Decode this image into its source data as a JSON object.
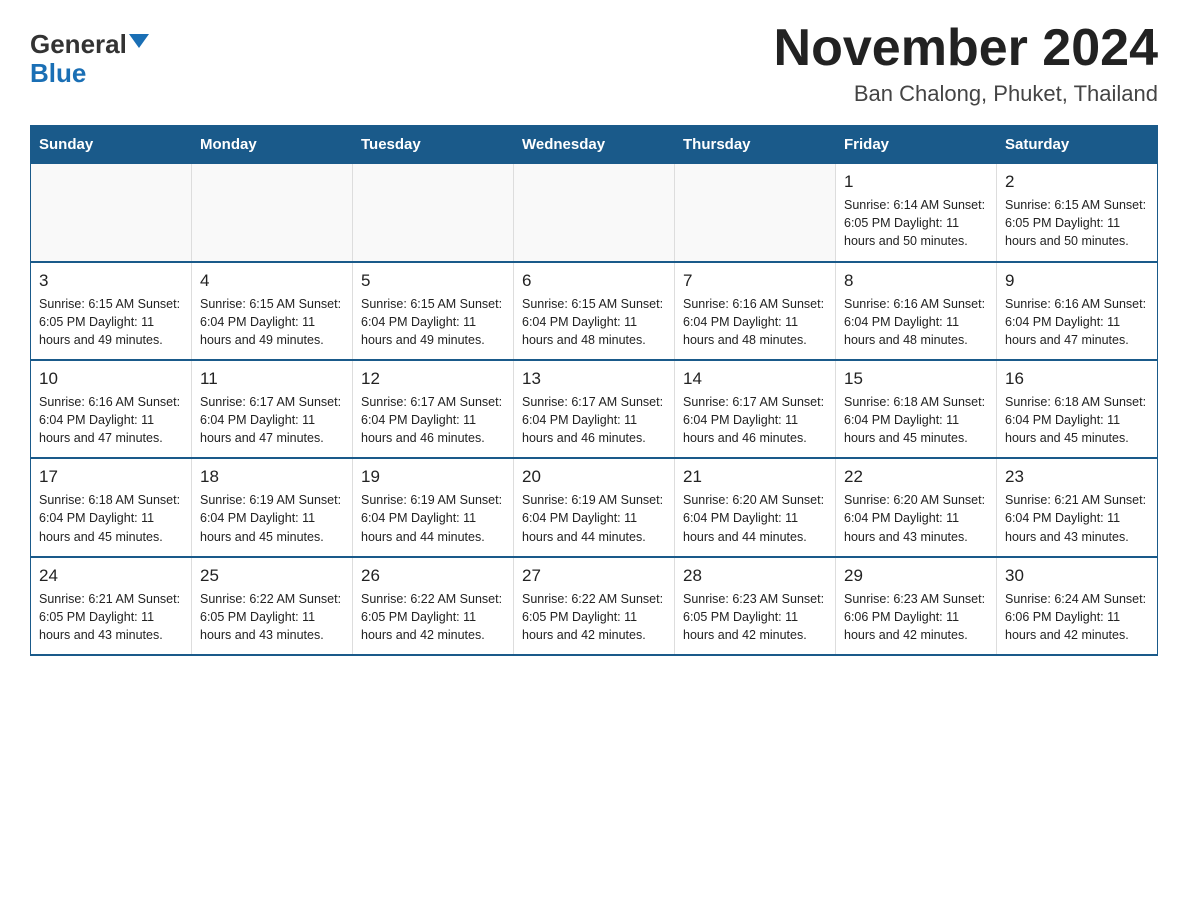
{
  "header": {
    "logo_general": "General",
    "logo_blue": "Blue",
    "month_title": "November 2024",
    "location": "Ban Chalong, Phuket, Thailand"
  },
  "days_of_week": [
    "Sunday",
    "Monday",
    "Tuesday",
    "Wednesday",
    "Thursday",
    "Friday",
    "Saturday"
  ],
  "weeks": [
    [
      {
        "day": "",
        "info": ""
      },
      {
        "day": "",
        "info": ""
      },
      {
        "day": "",
        "info": ""
      },
      {
        "day": "",
        "info": ""
      },
      {
        "day": "",
        "info": ""
      },
      {
        "day": "1",
        "info": "Sunrise: 6:14 AM\nSunset: 6:05 PM\nDaylight: 11 hours and 50 minutes."
      },
      {
        "day": "2",
        "info": "Sunrise: 6:15 AM\nSunset: 6:05 PM\nDaylight: 11 hours and 50 minutes."
      }
    ],
    [
      {
        "day": "3",
        "info": "Sunrise: 6:15 AM\nSunset: 6:05 PM\nDaylight: 11 hours and 49 minutes."
      },
      {
        "day": "4",
        "info": "Sunrise: 6:15 AM\nSunset: 6:04 PM\nDaylight: 11 hours and 49 minutes."
      },
      {
        "day": "5",
        "info": "Sunrise: 6:15 AM\nSunset: 6:04 PM\nDaylight: 11 hours and 49 minutes."
      },
      {
        "day": "6",
        "info": "Sunrise: 6:15 AM\nSunset: 6:04 PM\nDaylight: 11 hours and 48 minutes."
      },
      {
        "day": "7",
        "info": "Sunrise: 6:16 AM\nSunset: 6:04 PM\nDaylight: 11 hours and 48 minutes."
      },
      {
        "day": "8",
        "info": "Sunrise: 6:16 AM\nSunset: 6:04 PM\nDaylight: 11 hours and 48 minutes."
      },
      {
        "day": "9",
        "info": "Sunrise: 6:16 AM\nSunset: 6:04 PM\nDaylight: 11 hours and 47 minutes."
      }
    ],
    [
      {
        "day": "10",
        "info": "Sunrise: 6:16 AM\nSunset: 6:04 PM\nDaylight: 11 hours and 47 minutes."
      },
      {
        "day": "11",
        "info": "Sunrise: 6:17 AM\nSunset: 6:04 PM\nDaylight: 11 hours and 47 minutes."
      },
      {
        "day": "12",
        "info": "Sunrise: 6:17 AM\nSunset: 6:04 PM\nDaylight: 11 hours and 46 minutes."
      },
      {
        "day": "13",
        "info": "Sunrise: 6:17 AM\nSunset: 6:04 PM\nDaylight: 11 hours and 46 minutes."
      },
      {
        "day": "14",
        "info": "Sunrise: 6:17 AM\nSunset: 6:04 PM\nDaylight: 11 hours and 46 minutes."
      },
      {
        "day": "15",
        "info": "Sunrise: 6:18 AM\nSunset: 6:04 PM\nDaylight: 11 hours and 45 minutes."
      },
      {
        "day": "16",
        "info": "Sunrise: 6:18 AM\nSunset: 6:04 PM\nDaylight: 11 hours and 45 minutes."
      }
    ],
    [
      {
        "day": "17",
        "info": "Sunrise: 6:18 AM\nSunset: 6:04 PM\nDaylight: 11 hours and 45 minutes."
      },
      {
        "day": "18",
        "info": "Sunrise: 6:19 AM\nSunset: 6:04 PM\nDaylight: 11 hours and 45 minutes."
      },
      {
        "day": "19",
        "info": "Sunrise: 6:19 AM\nSunset: 6:04 PM\nDaylight: 11 hours and 44 minutes."
      },
      {
        "day": "20",
        "info": "Sunrise: 6:19 AM\nSunset: 6:04 PM\nDaylight: 11 hours and 44 minutes."
      },
      {
        "day": "21",
        "info": "Sunrise: 6:20 AM\nSunset: 6:04 PM\nDaylight: 11 hours and 44 minutes."
      },
      {
        "day": "22",
        "info": "Sunrise: 6:20 AM\nSunset: 6:04 PM\nDaylight: 11 hours and 43 minutes."
      },
      {
        "day": "23",
        "info": "Sunrise: 6:21 AM\nSunset: 6:04 PM\nDaylight: 11 hours and 43 minutes."
      }
    ],
    [
      {
        "day": "24",
        "info": "Sunrise: 6:21 AM\nSunset: 6:05 PM\nDaylight: 11 hours and 43 minutes."
      },
      {
        "day": "25",
        "info": "Sunrise: 6:22 AM\nSunset: 6:05 PM\nDaylight: 11 hours and 43 minutes."
      },
      {
        "day": "26",
        "info": "Sunrise: 6:22 AM\nSunset: 6:05 PM\nDaylight: 11 hours and 42 minutes."
      },
      {
        "day": "27",
        "info": "Sunrise: 6:22 AM\nSunset: 6:05 PM\nDaylight: 11 hours and 42 minutes."
      },
      {
        "day": "28",
        "info": "Sunrise: 6:23 AM\nSunset: 6:05 PM\nDaylight: 11 hours and 42 minutes."
      },
      {
        "day": "29",
        "info": "Sunrise: 6:23 AM\nSunset: 6:06 PM\nDaylight: 11 hours and 42 minutes."
      },
      {
        "day": "30",
        "info": "Sunrise: 6:24 AM\nSunset: 6:06 PM\nDaylight: 11 hours and 42 minutes."
      }
    ]
  ]
}
